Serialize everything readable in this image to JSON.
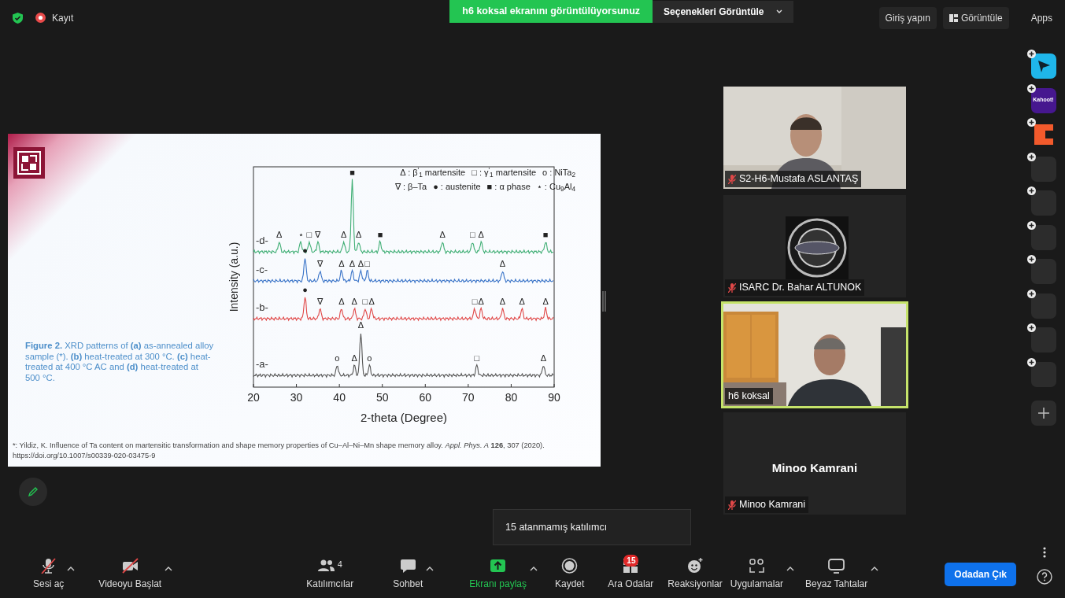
{
  "top_bar": {
    "recording_label": "Kayıt",
    "share_banner": "h6 koksal ekranını görüntülüyorsunuz",
    "view_options": "Seçenekleri Görüntüle",
    "sign_in": "Giriş yapın",
    "view_button": "Görüntüle",
    "apps_label": "Apps"
  },
  "slide": {
    "caption": [
      {
        "text": "Figure 2.",
        "bold": true
      },
      {
        "text": " XRD patterns of ",
        "bold": false
      },
      {
        "text": "(a)",
        "bold": true
      },
      {
        "text": " as-annealed alloy sample (*). ",
        "bold": false
      },
      {
        "text": "(b)",
        "bold": true
      },
      {
        "text": " heat-treated at 300 °C. ",
        "bold": false
      },
      {
        "text": "(c)",
        "bold": true
      },
      {
        "text": " heat-treated at 400 °C AC and ",
        "bold": false
      },
      {
        "text": "(d)",
        "bold": true
      },
      {
        "text": " heat-treated at 500 °C.",
        "bold": false
      }
    ],
    "footnote": [
      {
        "text": "*: Yildiz, K. Influence of Ta content on martensitic transformation and shape memory properties of Cu–Al–Ni–Mn shape memory alloy. ",
        "bold": false,
        "italic": false
      },
      {
        "text": "Appl. Phys. A",
        "bold": false,
        "italic": true
      },
      {
        "text": " 126",
        "bold": true,
        "italic": false
      },
      {
        "text": ", 307 (2020).",
        "bold": false,
        "italic": false
      }
    ],
    "footnote_url": "https://doi.org/10.1007/s00339-020-03475-9",
    "ylabel": "Intensity (a.u.)",
    "xlabel": "2-theta (Degree)",
    "xtick_labels": [
      "20",
      "30",
      "40",
      "50",
      "60",
      "70",
      "80",
      "90"
    ],
    "legend": [
      [
        "Δ : β$^{'}$$_{1}$ martensite",
        "□ : γ$^{'}$$_{1}$ martensite",
        "ο : NiTa$_{2}$"
      ],
      [
        "∇ : β–Ta",
        "● : austenite",
        "■ : α phase",
        "⋆ : Cu$_{9}$Al$_{4}$"
      ]
    ],
    "traces": [
      {
        "label": "-d-",
        "color": "#3fae74",
        "marks": [
          "Δ",
          "⋆",
          "□",
          "∇",
          "Δ",
          "■",
          "Δ",
          "■",
          "Δ",
          "□",
          "Δ",
          "■"
        ]
      },
      {
        "label": "-c-",
        "color": "#3a74c8",
        "marks": [
          "●",
          "∇",
          "Δ",
          "Δ",
          "Δ",
          "□",
          "Δ"
        ]
      },
      {
        "label": "-b-",
        "color": "#e04848",
        "marks": [
          "●",
          "∇",
          "Δ",
          "Δ",
          "□",
          "Δ",
          "□",
          "Δ",
          "Δ",
          "Δ",
          "Δ"
        ]
      },
      {
        "label": "-a-",
        "color": "#555555",
        "marks": [
          "ο",
          "Δ",
          "Δ",
          "ο",
          "□",
          "Δ"
        ]
      }
    ]
  },
  "participants": [
    {
      "kind": "camera",
      "name": "S2-H6-Mustafa ASLANTAŞ",
      "muted": true,
      "speaking": false
    },
    {
      "kind": "logo",
      "name": "ISARC Dr. Bahar ALTUNOK",
      "muted": true,
      "speaking": false
    },
    {
      "kind": "camera",
      "name": "h6 koksal",
      "muted": false,
      "speaking": true
    },
    {
      "kind": "off",
      "name": "Minoo Kamrani",
      "muted": true,
      "speaking": false,
      "center_name": "Minoo Kamrani"
    }
  ],
  "unassigned_tooltip": "15 atanmamış katılımcı",
  "apps_sidebar": [
    {
      "kind": "arrow-app"
    },
    {
      "kind": "kahoot",
      "label": "Kahoot!"
    },
    {
      "kind": "c-app"
    },
    {
      "kind": "empty"
    },
    {
      "kind": "empty"
    },
    {
      "kind": "empty"
    },
    {
      "kind": "empty"
    },
    {
      "kind": "empty"
    },
    {
      "kind": "empty"
    },
    {
      "kind": "empty"
    }
  ],
  "toolbar": [
    {
      "label": "Sesi aç",
      "kind": "mic-off",
      "caret": true,
      "highlighted": false
    },
    {
      "label": "Videoyu Başlat",
      "kind": "video-off",
      "caret": true,
      "highlighted": false
    },
    {
      "label": "Katılımcılar",
      "kind": "participants",
      "count": "4",
      "caret": false,
      "highlighted": false
    },
    {
      "label": "Sohbet",
      "kind": "chat",
      "caret": true,
      "highlighted": false
    },
    {
      "label": "Ekranı paylaş",
      "kind": "share",
      "caret": true,
      "highlighted": true
    },
    {
      "label": "Kaydet",
      "kind": "record",
      "caret": false,
      "highlighted": false
    },
    {
      "label": "Ara Odalar",
      "kind": "breakout",
      "badge": "15",
      "caret": false,
      "highlighted": false
    },
    {
      "label": "Reaksiyonlar",
      "kind": "reactions",
      "caret": false,
      "highlighted": false
    },
    {
      "label": "Uygulamalar",
      "kind": "apps",
      "caret": true,
      "highlighted": false
    },
    {
      "label": "Beyaz Tahtalar",
      "kind": "whiteboard",
      "caret": true,
      "highlighted": false
    }
  ],
  "leave_button": "Odadan Çık"
}
